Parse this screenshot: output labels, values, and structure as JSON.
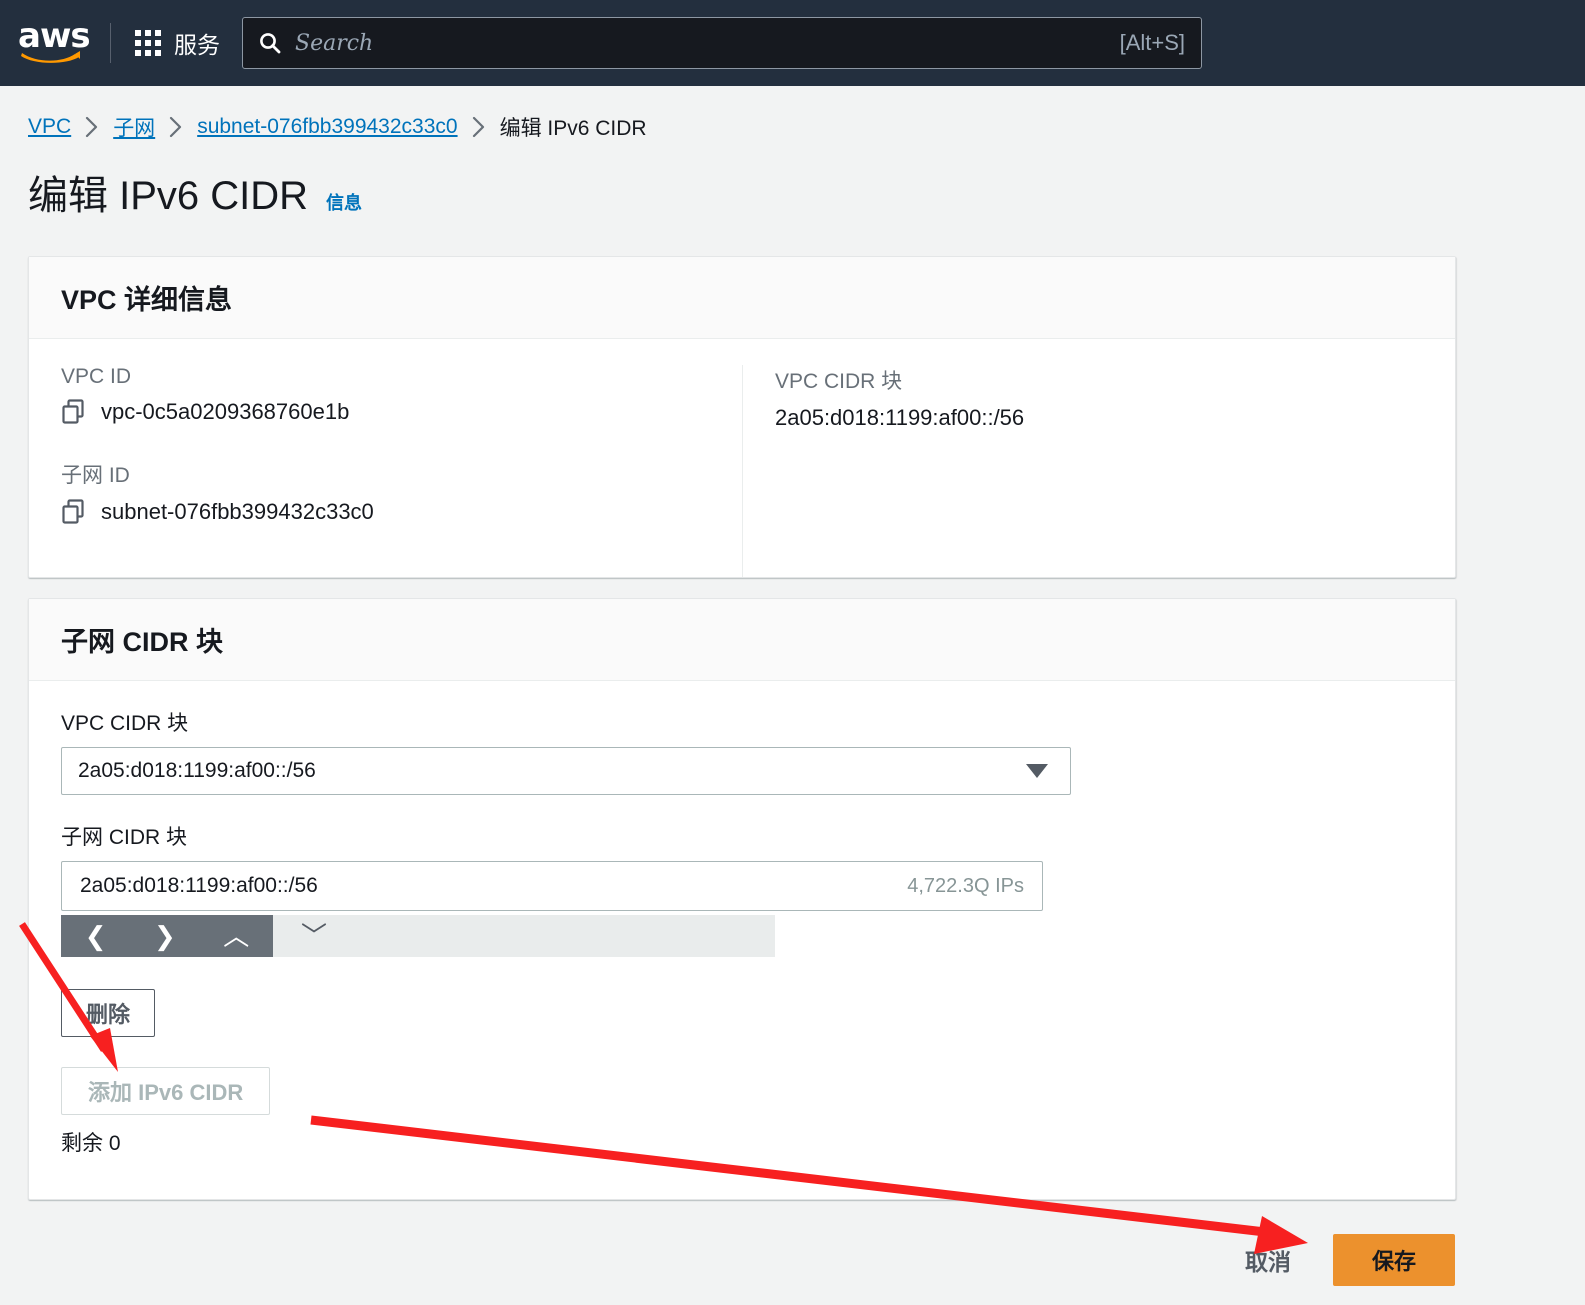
{
  "topnav": {
    "logo_text": "aws",
    "services_label": "服务",
    "search_placeholder": "Search",
    "search_value": "",
    "search_shortcut": "[Alt+S]"
  },
  "breadcrumb": {
    "items": [
      {
        "label": "VPC",
        "link": true
      },
      {
        "label": "子网",
        "link": true
      },
      {
        "label": "subnet-076fbb399432c33c0",
        "link": true
      },
      {
        "label": "编辑 IPv6 CIDR",
        "link": false
      }
    ]
  },
  "page": {
    "title": "编辑 IPv6 CIDR",
    "info_label": "信息"
  },
  "vpc_details": {
    "card_title": "VPC 详细信息",
    "vpc_id_label": "VPC ID",
    "vpc_id_value": "vpc-0c5a0209368760e1b",
    "subnet_id_label": "子网 ID",
    "subnet_id_value": "subnet-076fbb399432c33c0",
    "vpc_cidr_label": "VPC CIDR 块",
    "vpc_cidr_value": "2a05:d018:1199:af00::/56"
  },
  "subnet_cidr": {
    "card_title": "子网 CIDR 块",
    "vpc_cidr_field_label": "VPC CIDR 块",
    "vpc_cidr_selected": "2a05:d018:1199:af00::/56",
    "subnet_cidr_field_label": "子网 CIDR 块",
    "subnet_cidr_value": "2a05:d018:1199:af00::/56",
    "subnet_cidr_ip_count": "4,722.3Q IPs",
    "nav_strip": {
      "prev": "❮",
      "next": "❯",
      "up": "︿",
      "down": "﹀"
    },
    "delete_label": "删除",
    "add_label": "添加 IPv6 CIDR",
    "remaining_label": "剩余 0"
  },
  "footer": {
    "cancel_label": "取消",
    "save_label": "保存"
  },
  "colors": {
    "nav_bg": "#232f3e",
    "link": "#0073bb",
    "primary_button": "#ec912d",
    "annotation": "#f72020",
    "page_bg": "#f2f3f3"
  }
}
